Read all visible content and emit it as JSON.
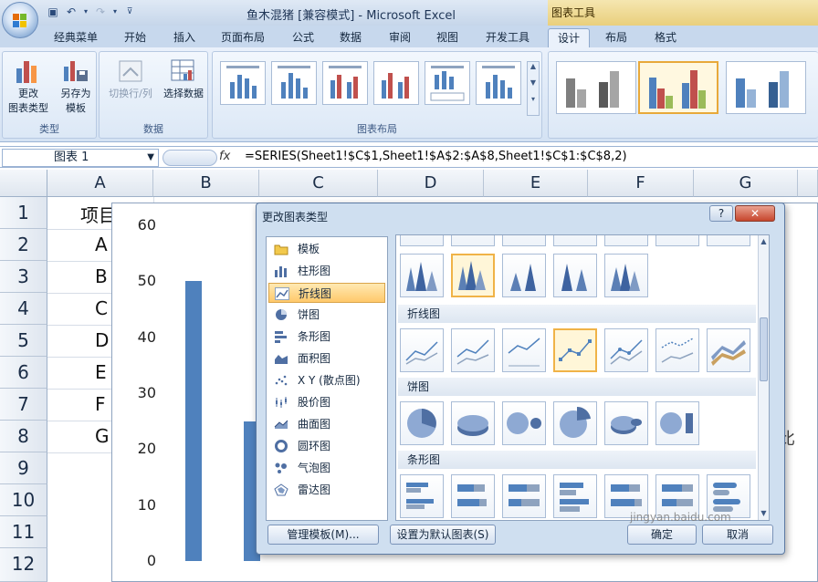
{
  "window": {
    "title": "鱼木混猪  [兼容模式] - Microsoft Excel",
    "chart_tools_label": "图表工具"
  },
  "tabs": [
    {
      "label": "经典菜单"
    },
    {
      "label": "开始"
    },
    {
      "label": "插入"
    },
    {
      "label": "页面布局"
    },
    {
      "label": "公式"
    },
    {
      "label": "数据"
    },
    {
      "label": "审阅"
    },
    {
      "label": "视图"
    },
    {
      "label": "开发工具"
    },
    {
      "label": "设计"
    },
    {
      "label": "布局"
    },
    {
      "label": "格式"
    }
  ],
  "ribbon": {
    "type_group": {
      "label": "类型",
      "change_type": "更改\n图表类型",
      "save_template": "另存为\n模板"
    },
    "data_group": {
      "label": "数据",
      "switch_rowcol": "切换行/列",
      "select_data": "选择数据"
    },
    "layout_group": {
      "label": "图表布局"
    }
  },
  "formula_bar": {
    "name_box": "图表 1",
    "fx": "fx",
    "formula": "=SERIES(Sheet1!$C$1,Sheet1!$A$2:$A$8,Sheet1!$C$1:$C$8,2)"
  },
  "columns": [
    "A",
    "B",
    "C",
    "D",
    "E",
    "F",
    "G"
  ],
  "rows": [
    "1",
    "2",
    "3",
    "4",
    "5",
    "6",
    "7",
    "8",
    "9",
    "10",
    "11",
    "12"
  ],
  "cells": {
    "a1": "项目",
    "a2": "A",
    "a3": "B",
    "a4": "C",
    "a5": "D",
    "a6": "E",
    "a7": "F",
    "a8": "G"
  },
  "chart_data": {
    "type": "bar",
    "yticks": [
      "60",
      "50",
      "40",
      "30",
      "20",
      "10",
      "0"
    ],
    "ylim": [
      0,
      60
    ],
    "values": [
      50,
      25
    ],
    "right_text": "比"
  },
  "dialog": {
    "title": "更改图表类型",
    "help": "?",
    "close": "✕",
    "types": [
      {
        "label": "模板",
        "icon": "folder-icon"
      },
      {
        "label": "柱形图",
        "icon": "column-chart-icon"
      },
      {
        "label": "折线图",
        "icon": "line-chart-icon"
      },
      {
        "label": "饼图",
        "icon": "pie-chart-icon"
      },
      {
        "label": "条形图",
        "icon": "bar-chart-icon"
      },
      {
        "label": "面积图",
        "icon": "area-chart-icon"
      },
      {
        "label": "X Y (散点图)",
        "icon": "scatter-chart-icon"
      },
      {
        "label": "股价图",
        "icon": "stock-chart-icon"
      },
      {
        "label": "曲面图",
        "icon": "surface-chart-icon"
      },
      {
        "label": "圆环图",
        "icon": "doughnut-chart-icon"
      },
      {
        "label": "气泡图",
        "icon": "bubble-chart-icon"
      },
      {
        "label": "雷达图",
        "icon": "radar-chart-icon"
      }
    ],
    "sections": {
      "line": "折线图",
      "pie": "饼图",
      "bar": "条形图"
    },
    "buttons": {
      "manage": "管理模板(M)...",
      "set_default": "设置为默认图表(S)",
      "ok": "确定",
      "cancel": "取消"
    }
  },
  "watermark": "jingyan.baidu.com",
  "colors": {
    "bar": "#4f81bd",
    "selected": "#ffc96b",
    "accent_red": "#c0504d",
    "accent_green": "#9bbb59"
  }
}
